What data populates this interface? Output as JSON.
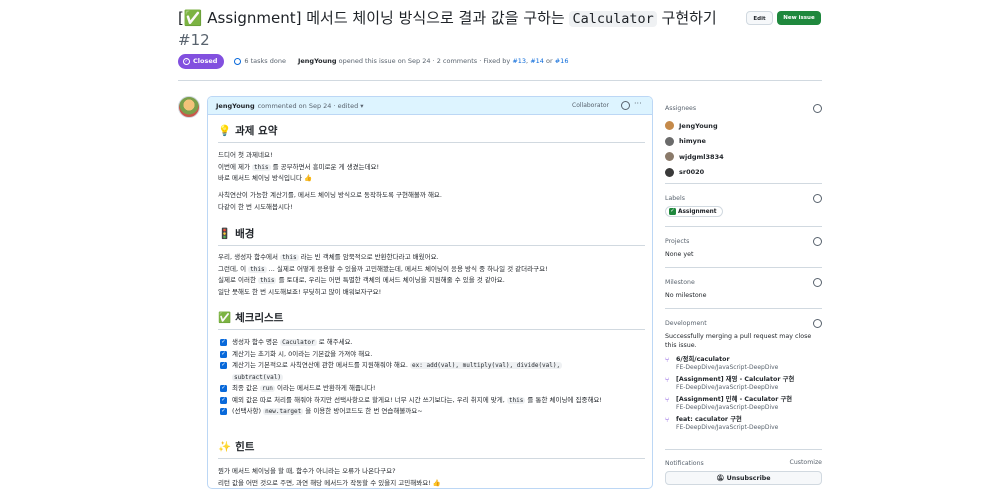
{
  "issue": {
    "title_prefix": "[✅ Assignment] 메서드 체이닝 방식으로 결과 값을 구하는",
    "title_code": "Calculator",
    "title_suffix": "구현하기",
    "number": "#12"
  },
  "header_buttons": {
    "edit": "Edit",
    "new_issue": "New issue"
  },
  "meta": {
    "status": "Closed",
    "tasks": "6 tasks done",
    "author": "JengYoung",
    "opened_text": "opened this issue on Sep 24 · 2 comments · Fixed by",
    "fixed_by": [
      "#13",
      "#14",
      "#16"
    ],
    "fixed_sep1": ",",
    "fixed_sep2": "or"
  },
  "comment": {
    "author": "JengYoung",
    "time": "commented on Sep 24 · edited ▾",
    "role": "Collaborator",
    "more": "···",
    "sections": {
      "summary_title": "과제 요약",
      "summary_emoji": "💡",
      "summary_lines": [
        "드디어 첫 과제네요!",
        "이번에 제가",
        "를 공부하면서 흥미로운 게 생겼는데요!",
        "바로 메서드 체이닝 방식입니다 👍"
      ],
      "summary_code": "this",
      "summary_lines2": [
        "사칙연산이 가능한 계산기를, 메서드 체이닝 방식으로 동작하도록 구현해볼까 해요.",
        "다같이 한 번 시도해봅시다!"
      ],
      "bg_title": "배경",
      "bg_emoji": "🚦",
      "bg_l1a": "우리, 생성자 함수에서",
      "bg_l1code": "this",
      "bg_l1b": "라는 빈 객체를 암묵적으로 반환한다라고 배웠어요.",
      "bg_l2a": "그런데, 이",
      "bg_l2code": "this",
      "bg_l2b": "... 실제로 어떻게 응용할 수 있을까 고민해봤는데, 메서드 체이닝이 응용 방식 중 하나일 것 같더라구요!",
      "bg_l3a": "실제로 이러한",
      "bg_l3code": "this",
      "bg_l3b": "를 토대로, 우리는 어떤 특별한 객체의 메서드 체이닝을 지원해줄 수 있을 것 같아요.",
      "bg_l4": "일단 뭇해도 한 번 시도해보죠! 부딪히고 많이 배워보자구요!",
      "check_title": "체크리스트",
      "check_emoji": "✅",
      "check_items": [
        {
          "a": "생성자 함수 명은",
          "code": "Caculator",
          "b": "로 해주세요."
        },
        {
          "a": "계산기는 초기화 시, 0이라는 기본값을 가져야 해요.",
          "code": "",
          "b": ""
        },
        {
          "a": "계산기는 기본적으로 사칙연산에 관한 메서드를 지원해줘야 해요.",
          "code": "ex: add(val), multiply(val), divide(val),",
          "b": ""
        },
        {
          "a": "",
          "code": "subtract(val)",
          "b": ""
        },
        {
          "a": "최종 값은",
          "code": "run",
          "b": "이라는 메서드로 반환하게 해줍니다!"
        },
        {
          "a": "예외 값은 따로 처리를 해줘야 하지만 선택사항으로 할게요! 너무 시간 쓰기보다는, 우리 취지에 맞게,",
          "code": "this",
          "b": "를 통한 체이닝에 집중해요!"
        },
        {
          "a": "(선택사항)",
          "code": "new.target",
          "b": "을 이용한 방어코드도 한 번 연습해볼까요~"
        }
      ],
      "hint_title": "힌트",
      "hint_emoji": "✨",
      "hint_lines": [
        "뭔가 메서드 체이닝을 할 때, 함수가 아니라는 오류가 나온다구요?",
        "리턴 값을 어떤 것으로 주면, 과연 해당 메서드가 작동할 수 있을지 고민해봐요! 👍"
      ]
    }
  },
  "sidebar": {
    "assignees_title": "Assignees",
    "assignees": [
      "JengYoung",
      "himyne",
      "wjdgml3834",
      "sr0020"
    ],
    "labels_title": "Labels",
    "label": "Assignment",
    "projects_title": "Projects",
    "projects_value": "None yet",
    "milestone_title": "Milestone",
    "milestone_value": "No milestone",
    "development_title": "Development",
    "development_text": "Successfully merging a pull request may close this issue.",
    "dev_items": [
      {
        "title": "6/정희/caculator",
        "repo": "FE-DeepDive/JavaScript-DeepDive"
      },
      {
        "title": "[Assignment] 재영 - Calculator 구현",
        "repo": "FE-DeepDive/JavaScript-DeepDive"
      },
      {
        "title": "[Assignment] 민혜 - Caculator 구현",
        "repo": "FE-DeepDive/JavaScript-DeepDive"
      },
      {
        "title": "feat: caculator 구현",
        "repo": "FE-DeepDive/JavaScript-DeepDive"
      }
    ],
    "notifications_title": "Notifications",
    "customize": "Customize",
    "unsubscribe": "Unsubscribe"
  }
}
